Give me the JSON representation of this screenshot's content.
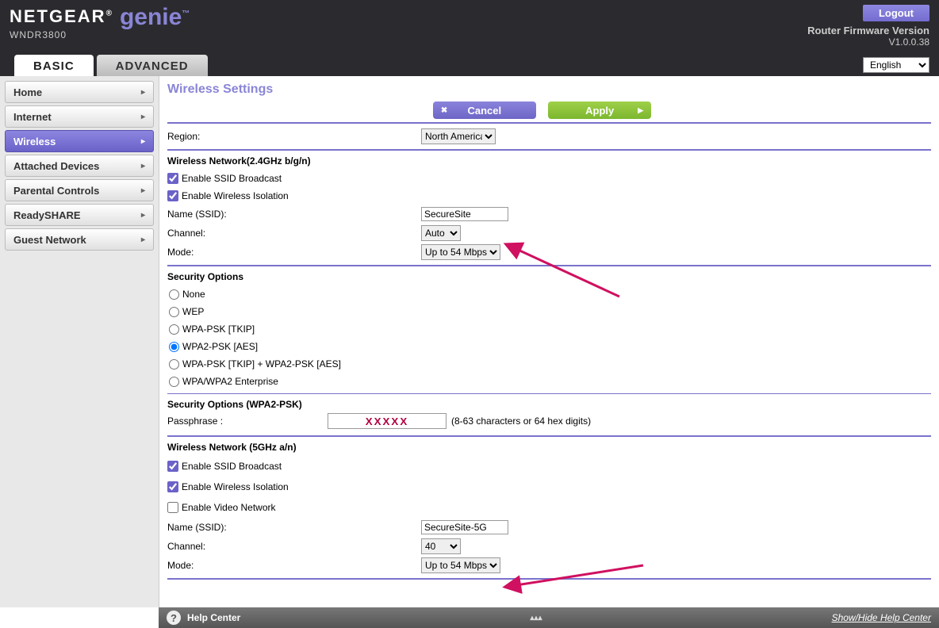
{
  "header": {
    "brand": "NETGEAR",
    "product": "genie",
    "model": "WNDR3800",
    "logout": "Logout",
    "fw_label": "Router Firmware Version",
    "fw_version": "V1.0.0.38",
    "language": "English"
  },
  "tabs": {
    "basic": "BASIC",
    "advanced": "ADVANCED"
  },
  "sidebar": {
    "items": [
      {
        "label": "Home",
        "active": false
      },
      {
        "label": "Internet",
        "active": false
      },
      {
        "label": "Wireless",
        "active": true
      },
      {
        "label": "Attached Devices",
        "active": false
      },
      {
        "label": "Parental Controls",
        "active": false
      },
      {
        "label": "ReadySHARE",
        "active": false
      },
      {
        "label": "Guest Network",
        "active": false
      }
    ]
  },
  "page": {
    "title": "Wireless Settings",
    "cancel": "Cancel",
    "apply": "Apply"
  },
  "region": {
    "label": "Region:",
    "value": "North America"
  },
  "net24": {
    "title": "Wireless Network(2.4GHz b/g/n)",
    "ssid_broadcast_label": "Enable SSID Broadcast",
    "ssid_broadcast_checked": true,
    "isolation_label": "Enable Wireless Isolation",
    "isolation_checked": true,
    "name_label": "Name (SSID):",
    "name_value": "SecureSite",
    "channel_label": "Channel:",
    "channel_value": "Auto",
    "mode_label": "Mode:",
    "mode_value": "Up to 54 Mbps"
  },
  "security": {
    "title": "Security Options",
    "options": [
      "None",
      "WEP",
      "WPA-PSK [TKIP]",
      "WPA2-PSK [AES]",
      "WPA-PSK [TKIP] + WPA2-PSK [AES]",
      "WPA/WPA2 Enterprise"
    ],
    "selected": "WPA2-PSK [AES]"
  },
  "wpa2": {
    "title": "Security Options (WPA2-PSK)",
    "pass_label": "Passphrase :",
    "pass_value": "XXXXX",
    "pass_hint": "(8-63 characters or 64 hex digits)"
  },
  "net5": {
    "title": "Wireless Network (5GHz a/n)",
    "ssid_broadcast_label": "Enable SSID Broadcast",
    "ssid_broadcast_checked": true,
    "isolation_label": "Enable Wireless Isolation",
    "isolation_checked": true,
    "video_label": "Enable Video Network",
    "video_checked": false,
    "name_label": "Name (SSID):",
    "name_value": "SecureSite-5G",
    "channel_label": "Channel:",
    "channel_value": "40",
    "mode_label": "Mode:",
    "mode_value": "Up to 54 Mbps"
  },
  "help": {
    "title": "Help Center",
    "show_hide": "Show/Hide Help Center"
  }
}
